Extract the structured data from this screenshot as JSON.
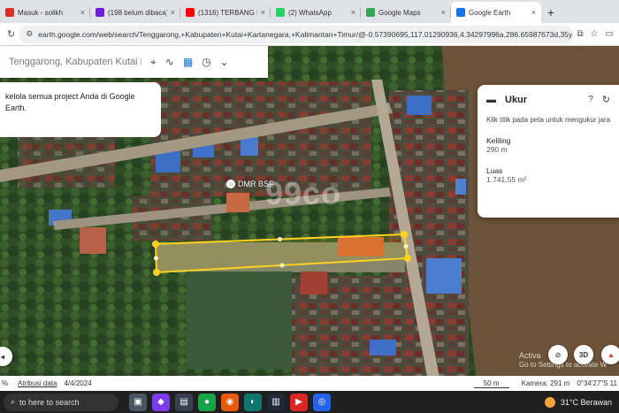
{
  "browser": {
    "tabs": [
      {
        "title": "Masuk - solikh",
        "color": "#d93025"
      },
      {
        "title": "(198 belum dibaca) -",
        "color": "#6d1ed1"
      },
      {
        "title": "(1316) TERBANG DIAT",
        "color": "#ff0000"
      },
      {
        "title": "(2) WhatsApp",
        "color": "#25d366"
      },
      {
        "title": "Google Maps",
        "color": "#34a853"
      },
      {
        "title": "Google Earth",
        "color": "#1a73e8"
      }
    ],
    "url": "earth.google.com/web/search/Tenggarong,+Kabupaten+Kutai+Kartanegara,+Kalimantan+Timur/@-0.57390695,117.01290936,4.34297996a,286.65987673d,35y..."
  },
  "search": {
    "placeholder": "Tenggarong, Kabupaten Kutai Ka"
  },
  "info_card": {
    "text": "kelola semua project Anda di Google Earth."
  },
  "map": {
    "place_label": "DMR BSF",
    "watermark": "99co",
    "scale_label": "50 m"
  },
  "measure_panel": {
    "title": "Ukur",
    "instruction": "Klik titik pada peta untuk mengukur jara",
    "perimeter_label": "Keliling",
    "perimeter_value": "290 m",
    "area_label": "Luas",
    "area_value": "1.741,55 m²"
  },
  "map_controls": {
    "view_3d": "3D"
  },
  "status_bar": {
    "zoom": "%",
    "attribution": "Atribusi data",
    "date": "4/4/2024",
    "camera": "Kamera: 291 m",
    "coords": "0°34'27\"S 11"
  },
  "windows_notice": {
    "line1": "Activa",
    "line2": "Go to Settings to activate W"
  },
  "taskbar": {
    "search_placeholder": "to here to search",
    "weather": "31°C  Berawan"
  }
}
